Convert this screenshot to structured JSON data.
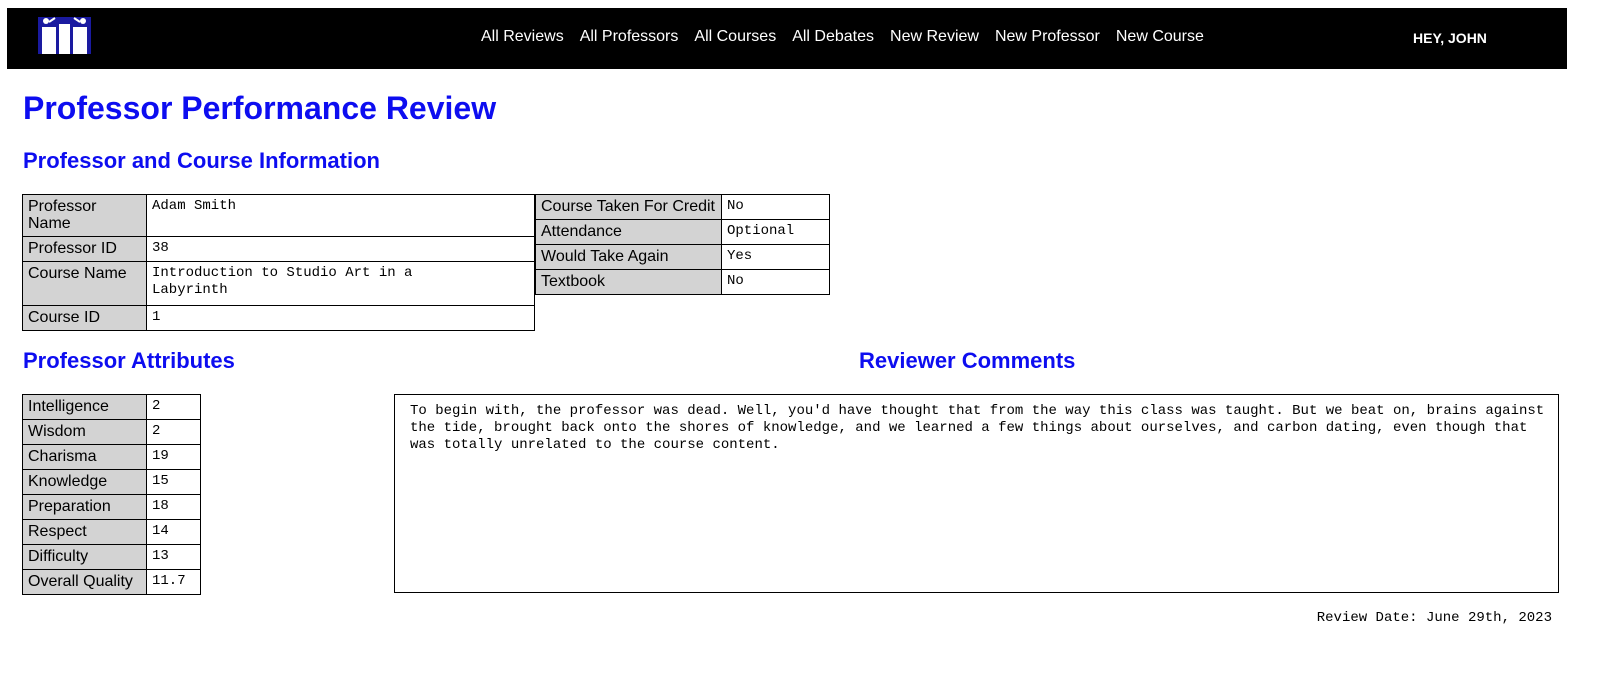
{
  "nav": {
    "links": [
      "All Reviews",
      "All Professors",
      "All Courses",
      "All Debates",
      "New Review",
      "New Professor",
      "New Course"
    ],
    "user_greeting": "HEY, JOHN"
  },
  "page_title": "Professor Performance Review",
  "course_info": {
    "heading": "Professor and Course Information",
    "left_rows": [
      {
        "label": "Professor Name",
        "value": "Adam Smith"
      },
      {
        "label": "Professor ID",
        "value": "38"
      },
      {
        "label": "Course Name",
        "value": "Introduction to Studio Art in a Labyrinth"
      },
      {
        "label": "Course ID",
        "value": "1"
      }
    ],
    "right_rows": [
      {
        "label": "Course Taken For Credit",
        "value": "No"
      },
      {
        "label": "Attendance",
        "value": "Optional"
      },
      {
        "label": "Would Take Again",
        "value": "Yes"
      },
      {
        "label": "Textbook",
        "value": "No"
      }
    ]
  },
  "attributes": {
    "heading": "Professor Attributes",
    "rows": [
      {
        "label": "Intelligence",
        "value": "2"
      },
      {
        "label": "Wisdom",
        "value": "2"
      },
      {
        "label": "Charisma",
        "value": "19"
      },
      {
        "label": "Knowledge",
        "value": "15"
      },
      {
        "label": "Preparation",
        "value": "18"
      },
      {
        "label": "Respect",
        "value": "14"
      },
      {
        "label": "Difficulty",
        "value": "13"
      },
      {
        "label": "Overall Quality",
        "value": "11.7"
      }
    ]
  },
  "comments": {
    "heading": "Reviewer Comments",
    "text": "To begin with, the professor was dead. Well, you'd have thought that from the way this class was taught. But we beat on, brains against the tide, brought back onto the shores of knowledge, and we learned a few things about ourselves, and carbon dating, even though that was totally unrelated to the course content.",
    "review_date": "Review Date: June 29th, 2023"
  }
}
